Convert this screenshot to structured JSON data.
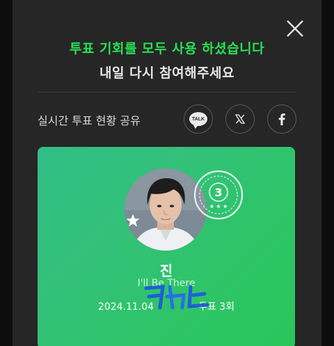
{
  "modal": {
    "headline": "투표 기회를 모두 사용 하셨습니다",
    "subline": "내일 다시 참여해주세요",
    "close_icon": "close-icon"
  },
  "share": {
    "title": "실시간 투표 현황 공유",
    "buttons": [
      {
        "name": "kakao-talk-share",
        "label": "TALK",
        "icon": "kakaotalk-icon"
      },
      {
        "name": "x-share",
        "icon": "x-logo-icon"
      },
      {
        "name": "facebook-share",
        "icon": "facebook-icon"
      }
    ]
  },
  "card": {
    "artist": "진",
    "song": "I'll Be There",
    "date": "2024.11.04",
    "vote_text": "누적 투표 3회",
    "vote_label": "투표 3회",
    "badge_count": "3",
    "colors": {
      "from": "#30be86",
      "to": "#29c75a",
      "headline": "#27e055"
    }
  }
}
